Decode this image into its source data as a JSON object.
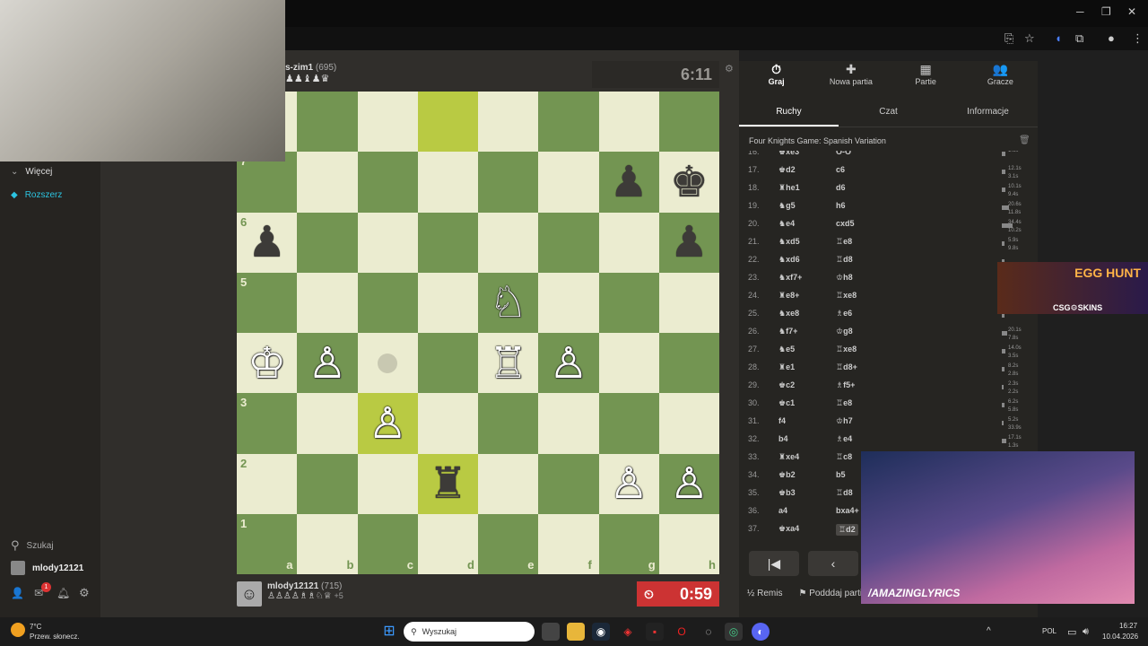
{
  "board": {
    "files": [
      "a",
      "b",
      "c",
      "d",
      "e",
      "f",
      "g",
      "h"
    ],
    "ranks": [
      "1",
      "2",
      "3",
      "5",
      "6",
      "7"
    ],
    "pieces": [
      {
        "type": "king",
        "color": "black",
        "sq": "h7"
      },
      {
        "type": "pawn",
        "color": "black",
        "sq": "g7"
      },
      {
        "type": "pawn",
        "color": "black",
        "sq": "a6"
      },
      {
        "type": "pawn",
        "color": "black",
        "sq": "h6"
      },
      {
        "type": "knight",
        "color": "white",
        "sq": "e5"
      },
      {
        "type": "king",
        "color": "white",
        "sq": "a4"
      },
      {
        "type": "pawn",
        "color": "white",
        "sq": "b4"
      },
      {
        "type": "rook",
        "color": "white",
        "sq": "e4"
      },
      {
        "type": "pawn",
        "color": "white",
        "sq": "f4"
      },
      {
        "type": "pawn",
        "color": "white",
        "sq": "c3"
      },
      {
        "type": "rook",
        "color": "black",
        "sq": "d2"
      },
      {
        "type": "pawn",
        "color": "white",
        "sq": "g2"
      },
      {
        "type": "pawn",
        "color": "white",
        "sq": "h2"
      }
    ],
    "highlights": [
      "d8",
      "c3",
      "d2"
    ],
    "move_dot": "c4"
  },
  "players": {
    "top": {
      "name": "s-zim1",
      "rating": "(695)",
      "captured": "♟♟♝♟♛"
    },
    "bottom": {
      "name": "mlody12121",
      "rating": "(715)",
      "captured": "♙♙♙♙♗♗♘♕",
      "material": "+5"
    }
  },
  "clocks": {
    "top": "6:11",
    "bottom": "0:59"
  },
  "nav": {
    "tabs": [
      {
        "icon": "⏱",
        "label": "Graj"
      },
      {
        "icon": "✚",
        "label": "Nowa partia"
      },
      {
        "icon": "▦",
        "label": "Partie"
      },
      {
        "icon": "👥",
        "label": "Gracze"
      }
    ],
    "subtabs": [
      "Ruchy",
      "Czat",
      "Informacje"
    ]
  },
  "opening": "Four Knights Game: Spanish Variation",
  "moves": [
    {
      "n": "16.",
      "w": "♚xe3",
      "b": "O-O",
      "tw": "1.6s",
      "tb": "",
      "bw": 4
    },
    {
      "n": "17.",
      "w": "♚d2",
      "b": "c6",
      "tw": "12.1s",
      "tb": "3.1s",
      "bw": 4
    },
    {
      "n": "18.",
      "w": "♜he1",
      "b": "d6",
      "tw": "10.1s",
      "tb": "9.4s",
      "bw": 4
    },
    {
      "n": "19.",
      "w": "♞g5",
      "b": "h6",
      "tw": "20.6s",
      "tb": "11.8s",
      "bw": 8
    },
    {
      "n": "20.",
      "w": "♞e4",
      "b": "cxd5",
      "tw": "34.4s",
      "tb": "10.2s",
      "bw": 12
    },
    {
      "n": "21.",
      "w": "♞xd5",
      "b": "♖e8",
      "tw": "5.9s",
      "tb": "9.8s",
      "bw": 3
    },
    {
      "n": "22.",
      "w": "♞xd6",
      "b": "♖d8",
      "tw": "",
      "tb": "6.5s",
      "bw": 3
    },
    {
      "n": "23.",
      "w": "♞xf7+",
      "b": "♔h8",
      "tw": "",
      "tb": "",
      "bw": 3
    },
    {
      "n": "24.",
      "w": "♜e8+",
      "b": "♖xe8",
      "tw": "",
      "tb": "",
      "bw": 3
    },
    {
      "n": "25.",
      "w": "♞xe8",
      "b": "♗e6",
      "tw": "2.8s",
      "tb": "",
      "bw": 3
    },
    {
      "n": "26.",
      "w": "♞f7+",
      "b": "♔g8",
      "tw": "20.1s",
      "tb": "7.8s",
      "bw": 6
    },
    {
      "n": "27.",
      "w": "♞e5",
      "b": "♖xe8",
      "tw": "14.0s",
      "tb": "3.5s",
      "bw": 4
    },
    {
      "n": "28.",
      "w": "♜e1",
      "b": "♖d8+",
      "tw": "8.2s",
      "tb": "2.8s",
      "bw": 3
    },
    {
      "n": "29.",
      "w": "♚c2",
      "b": "♗f5+",
      "tw": "2.3s",
      "tb": "2.2s",
      "bw": 2
    },
    {
      "n": "30.",
      "w": "♚c1",
      "b": "♖e8",
      "tw": "6.2s",
      "tb": "5.8s",
      "bw": 3
    },
    {
      "n": "31.",
      "w": "f4",
      "b": "♔h7",
      "tw": "5.2s",
      "tb": "33.9s",
      "bw": 2
    },
    {
      "n": "32.",
      "w": "b4",
      "b": "♗e4",
      "tw": "17.1s",
      "tb": "1.3s",
      "bw": 5
    },
    {
      "n": "33.",
      "w": "♜xe4",
      "b": "♖c8",
      "tw": "",
      "tb": "",
      "bw": 3
    },
    {
      "n": "34.",
      "w": "♚b2",
      "b": "b5",
      "tw": "",
      "tb": "",
      "bw": 3
    },
    {
      "n": "35.",
      "w": "♚b3",
      "b": "♖d8",
      "tw": "",
      "tb": "",
      "bw": 3
    },
    {
      "n": "36.",
      "w": "a4",
      "b": "bxa4+",
      "tw": "",
      "tb": "",
      "bw": 3
    },
    {
      "n": "37.",
      "w": "♚xa4",
      "b": "♖d2",
      "tw": "",
      "tb": "",
      "bw": 3
    }
  ],
  "actions": {
    "draw": "½ Remis",
    "resign": "Podddaj partię"
  },
  "sidebar": {
    "more": "Więcej",
    "expand": "Rozszerz",
    "search": "Szukaj",
    "user": "mlody12121",
    "mail_badge": "1"
  },
  "overlays": {
    "ad_title": "EGG HUNT",
    "ad_sub": "CSG⚙SKINS",
    "lyrics": "/AMAZINGLYRICS"
  },
  "taskbar": {
    "search_placeholder": "Wyszukaj",
    "weather_temp": "7°C",
    "weather_desc": "Przew. słonecz.",
    "lang": "POL",
    "time": "16:27",
    "date": "10.04.2026"
  },
  "colors": {
    "board_light": "#ebecd0",
    "board_dark": "#739552",
    "clock_red": "#cc3333",
    "gem": "#2cc3e0"
  }
}
